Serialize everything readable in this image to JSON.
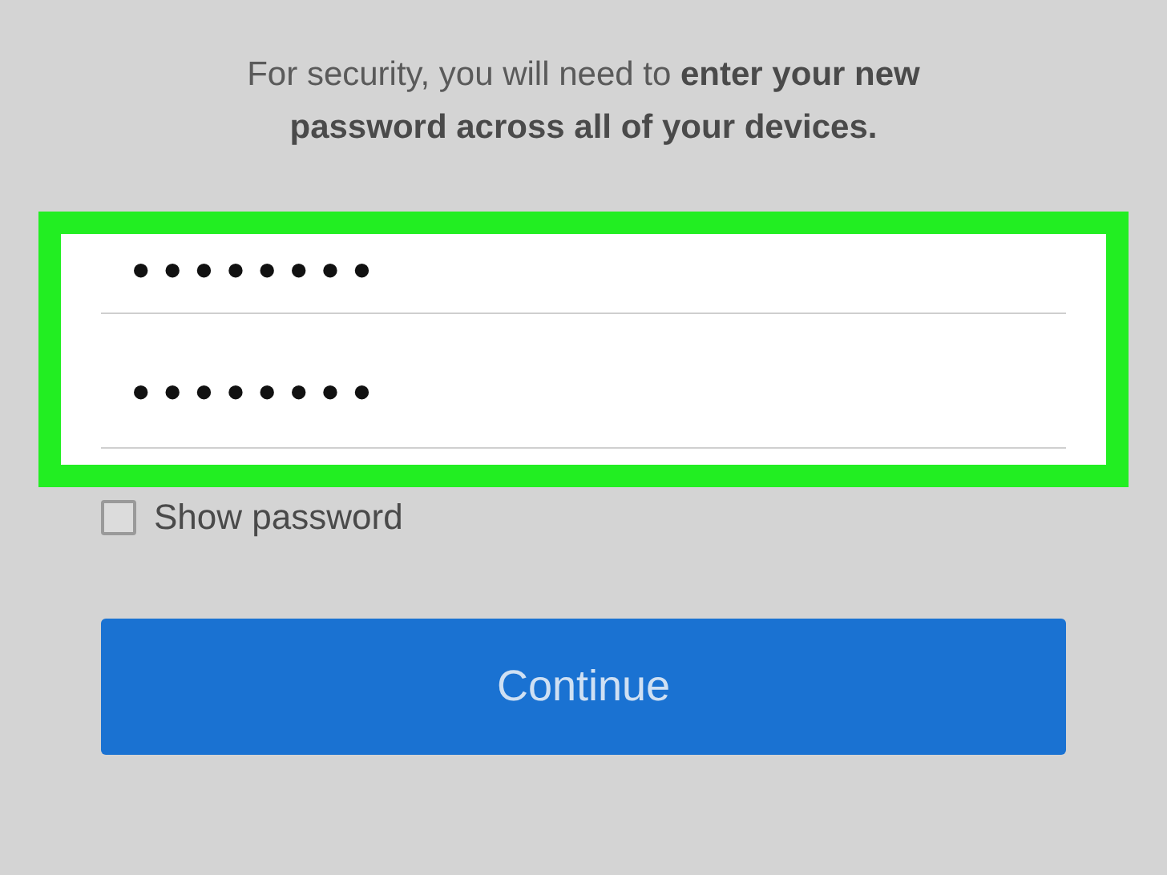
{
  "message": "For security, you will need to **enter your new password across all of your devices.**",
  "form": {
    "highlighted": true,
    "fields": [
      {
        "value": "••••••••"
      },
      {
        "value": "••••••••"
      }
    ]
  },
  "show_password": {
    "label": "Show password",
    "checked": false
  },
  "continue_button": {
    "label": "Continue"
  }
}
